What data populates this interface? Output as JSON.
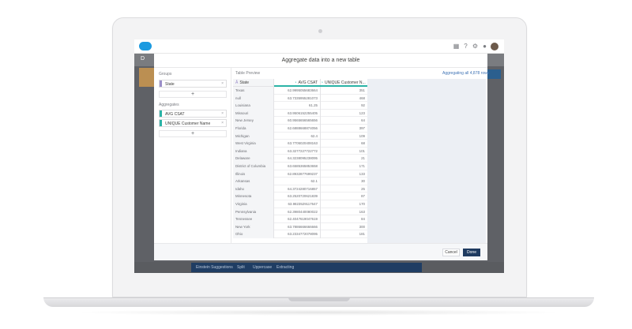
{
  "header": {
    "icons": [
      "grid-icon",
      "help-icon",
      "gear-icon",
      "notification-icon"
    ],
    "sub_title": "D"
  },
  "modal": {
    "title": "Aggregate data into a new table",
    "groups_label": "Groups",
    "groups": [
      {
        "label": "State",
        "color": "#9b8ec8"
      }
    ],
    "aggregates_label": "Aggregates",
    "aggregates": [
      {
        "label": "AVG CSAT",
        "color": "#2bb3a6"
      },
      {
        "label": "UNIQUE Customer Name",
        "color": "#2bb3a6"
      }
    ],
    "add_symbol": "+",
    "remove_symbol": "×",
    "preview_label": "Table Preview",
    "aggregating_note": "Aggregating all 4,878 rows",
    "columns": [
      {
        "label": "State",
        "icon": "dimension-icon",
        "accent": "#9b8ec8"
      },
      {
        "label": "AVG CSAT",
        "icon": "measure-icon",
        "accent": "#2bb3a6"
      },
      {
        "label": "UNIQUE Customer N...",
        "icon": "measure-icon",
        "accent": "#2bb3a6"
      }
    ],
    "rows": [
      [
        "Texas",
        "62.9995055683664",
        "351"
      ],
      [
        "null",
        "63.7335955281073",
        "468"
      ],
      [
        "Louisiana",
        "61.25",
        "92"
      ],
      [
        "Missouri",
        "63.9506152255405",
        "123"
      ],
      [
        "New Jersey",
        "60.9565656565656",
        "64"
      ],
      [
        "Florida",
        "62.6888668874056",
        "397"
      ],
      [
        "Michigan",
        "62.4",
        "109"
      ],
      [
        "West Virginia",
        "63.7705020408163",
        "68"
      ],
      [
        "Indiana",
        "63.3277227722772",
        "101"
      ],
      [
        "Delaware",
        "64.3238095238095",
        "21"
      ],
      [
        "District of Columbia",
        "63.6585365853658",
        "171"
      ],
      [
        "Illinois",
        "62.8932877699237",
        "133"
      ],
      [
        "Arkansas",
        "62.1",
        "30"
      ],
      [
        "Idaho",
        "64.3724280716857",
        "25"
      ],
      [
        "Minnesota",
        "63.2520720621839",
        "87"
      ],
      [
        "Virginia",
        "63.9823529117647",
        "170"
      ],
      [
        "Pennsylvania",
        "62.3980440080022",
        "163"
      ],
      [
        "Tennessee",
        "62.4047619047619",
        "84"
      ],
      [
        "New York",
        "63.7886666666666",
        "300"
      ],
      [
        "Ohio",
        "63.2334772078095",
        "181"
      ]
    ],
    "cancel_label": "Cancel",
    "done_label": "Done"
  },
  "background": {
    "bottom_bar": [
      "Einstein Suggestions",
      "Split",
      "Uppercase",
      "Extracting"
    ]
  }
}
